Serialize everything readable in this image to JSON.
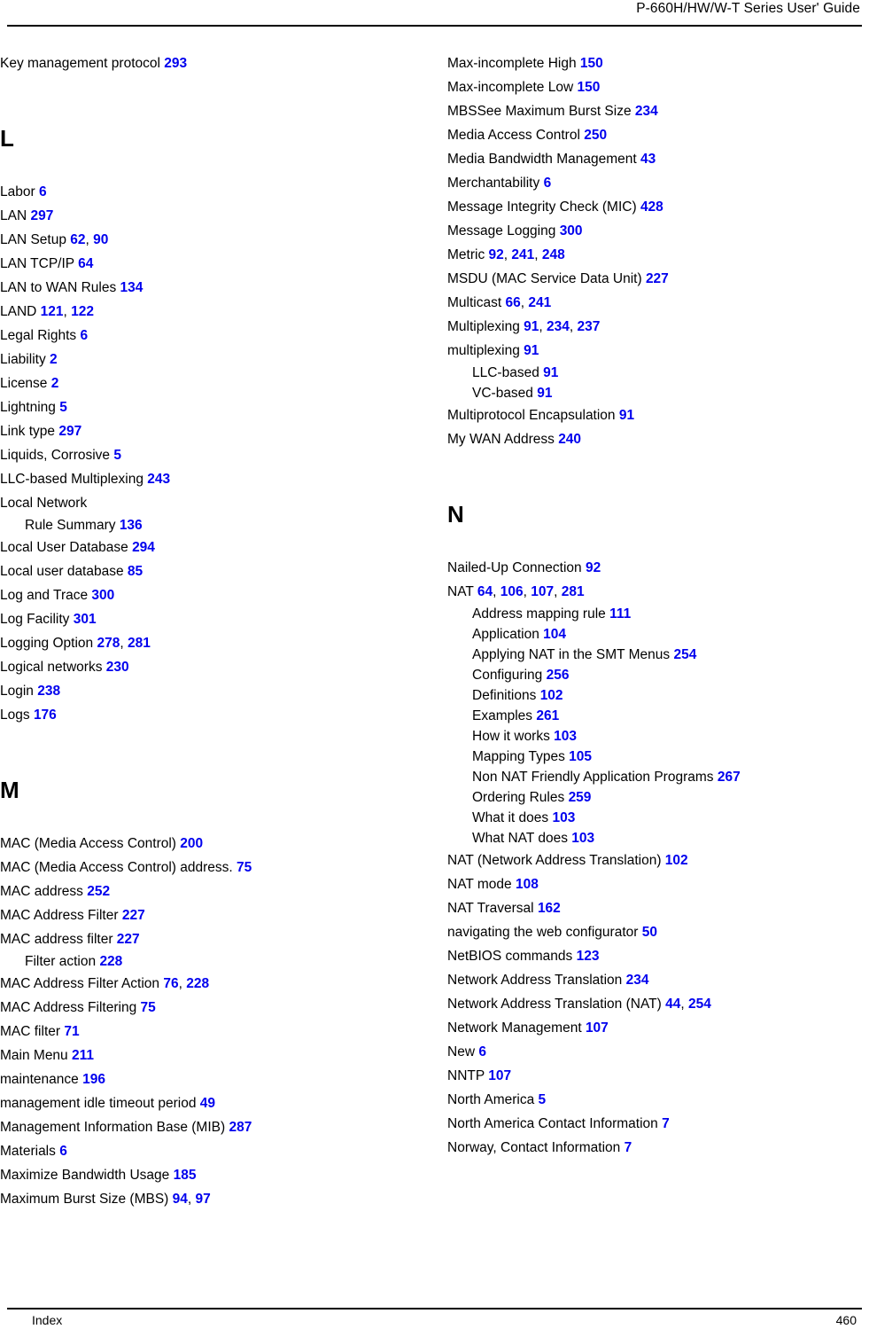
{
  "header": {
    "title": "P-660H/HW/W-T Series User' Guide"
  },
  "footer": {
    "section_label": "Index",
    "page_number": "460"
  },
  "colors": {
    "page_number_link": "#0000EE",
    "text": "#000000",
    "background": "#FFFFFF"
  },
  "index": {
    "left_column": {
      "lead_entries": [
        {
          "term": "Key management protocol",
          "pages": [
            "293"
          ],
          "level": 0
        }
      ],
      "groups": [
        {
          "letter": "L",
          "entries": [
            {
              "term": "Labor",
              "pages": [
                "6"
              ],
              "level": 0
            },
            {
              "term": "LAN",
              "pages": [
                "297"
              ],
              "level": 0
            },
            {
              "term": "LAN Setup",
              "pages": [
                "62",
                "90"
              ],
              "level": 0
            },
            {
              "term": "LAN TCP/IP",
              "pages": [
                "64"
              ],
              "level": 0
            },
            {
              "term": "LAN to WAN Rules",
              "pages": [
                "134"
              ],
              "level": 0
            },
            {
              "term": "LAND",
              "pages": [
                "121",
                "122"
              ],
              "level": 0
            },
            {
              "term": "Legal Rights",
              "pages": [
                "6"
              ],
              "level": 0
            },
            {
              "term": "Liability",
              "pages": [
                "2"
              ],
              "level": 0
            },
            {
              "term": "License",
              "pages": [
                "2"
              ],
              "level": 0
            },
            {
              "term": "Lightning",
              "pages": [
                "5"
              ],
              "level": 0
            },
            {
              "term": "Link type",
              "pages": [
                "297"
              ],
              "level": 0
            },
            {
              "term": "Liquids, Corrosive",
              "pages": [
                "5"
              ],
              "level": 0
            },
            {
              "term": "LLC-based Multiplexing",
              "pages": [
                "243"
              ],
              "level": 0
            },
            {
              "term": "Local Network",
              "pages": [],
              "level": 0
            },
            {
              "term": "Rule Summary",
              "pages": [
                "136"
              ],
              "level": 1
            },
            {
              "term": "Local User Database",
              "pages": [
                "294"
              ],
              "level": 0
            },
            {
              "term": "Local user database",
              "pages": [
                "85"
              ],
              "level": 0
            },
            {
              "term": "Log and Trace",
              "pages": [
                "300"
              ],
              "level": 0
            },
            {
              "term": "Log Facility",
              "pages": [
                "301"
              ],
              "level": 0
            },
            {
              "term": "Logging Option",
              "pages": [
                "278",
                "281"
              ],
              "level": 0
            },
            {
              "term": "Logical networks",
              "pages": [
                "230"
              ],
              "level": 0
            },
            {
              "term": "Login",
              "pages": [
                "238"
              ],
              "level": 0
            },
            {
              "term": "Logs",
              "pages": [
                "176"
              ],
              "level": 0
            }
          ]
        },
        {
          "letter": "M",
          "entries": [
            {
              "term": "MAC (Media Access Control)",
              "pages": [
                "200"
              ],
              "level": 0
            },
            {
              "term": "MAC (Media Access Control) address.",
              "pages": [
                "75"
              ],
              "level": 0
            },
            {
              "term": "MAC address",
              "pages": [
                "252"
              ],
              "level": 0
            },
            {
              "term": "MAC Address Filter",
              "pages": [
                "227"
              ],
              "level": 0
            },
            {
              "term": "MAC address filter",
              "pages": [
                "227"
              ],
              "level": 0
            },
            {
              "term": "Filter action",
              "pages": [
                "228"
              ],
              "level": 1
            },
            {
              "term": "MAC Address Filter Action",
              "pages": [
                "76",
                "228"
              ],
              "level": 0
            },
            {
              "term": "MAC Address Filtering",
              "pages": [
                "75"
              ],
              "level": 0
            },
            {
              "term": "MAC filter",
              "pages": [
                "71"
              ],
              "level": 0
            },
            {
              "term": "Main Menu",
              "pages": [
                "211"
              ],
              "level": 0
            },
            {
              "term": "maintenance",
              "pages": [
                "196"
              ],
              "level": 0
            },
            {
              "term": "management idle timeout period",
              "pages": [
                "49"
              ],
              "level": 0
            },
            {
              "term": "Management Information Base (MIB)",
              "pages": [
                "287"
              ],
              "level": 0
            },
            {
              "term": "Materials",
              "pages": [
                "6"
              ],
              "level": 0
            },
            {
              "term": "Maximize Bandwidth Usage",
              "pages": [
                "185"
              ],
              "level": 0
            },
            {
              "term": "Maximum Burst Size (MBS)",
              "pages": [
                "94",
                "97"
              ],
              "level": 0
            }
          ]
        }
      ]
    },
    "right_column": {
      "lead_entries": [
        {
          "term": "Max-incomplete High",
          "pages": [
            "150"
          ],
          "level": 0
        },
        {
          "term": "Max-incomplete Low",
          "pages": [
            "150"
          ],
          "level": 0
        },
        {
          "term": "MBSSee Maximum Burst Size",
          "pages": [
            "234"
          ],
          "level": 0
        },
        {
          "term": "Media Access Control",
          "pages": [
            "250"
          ],
          "level": 0
        },
        {
          "term": "Media Bandwidth Management",
          "pages": [
            "43"
          ],
          "level": 0
        },
        {
          "term": "Merchantability",
          "pages": [
            "6"
          ],
          "level": 0
        },
        {
          "term": "Message Integrity Check (MIC)",
          "pages": [
            "428"
          ],
          "level": 0
        },
        {
          "term": "Message Logging",
          "pages": [
            "300"
          ],
          "level": 0
        },
        {
          "term": "Metric",
          "pages": [
            "92",
            "241",
            "248"
          ],
          "level": 0
        },
        {
          "term": "MSDU (MAC Service Data Unit)",
          "pages": [
            "227"
          ],
          "level": 0
        },
        {
          "term": "Multicast",
          "pages": [
            "66",
            "241"
          ],
          "level": 0
        },
        {
          "term": "Multiplexing",
          "pages": [
            "91",
            "234",
            "237"
          ],
          "level": 0
        },
        {
          "term": "multiplexing",
          "pages": [
            "91"
          ],
          "level": 0
        },
        {
          "term": "LLC-based",
          "pages": [
            "91"
          ],
          "level": 1
        },
        {
          "term": "VC-based",
          "pages": [
            "91"
          ],
          "level": 1
        },
        {
          "term": "Multiprotocol Encapsulation",
          "pages": [
            "91"
          ],
          "level": 0
        },
        {
          "term": "My WAN Address",
          "pages": [
            "240"
          ],
          "level": 0
        }
      ],
      "groups": [
        {
          "letter": "N",
          "entries": [
            {
              "term": "Nailed-Up Connection",
              "pages": [
                "92"
              ],
              "level": 0
            },
            {
              "term": "NAT",
              "pages": [
                "64",
                "106",
                "107",
                "281"
              ],
              "level": 0
            },
            {
              "term": "Address mapping rule",
              "pages": [
                "111"
              ],
              "level": 1
            },
            {
              "term": "Application",
              "pages": [
                "104"
              ],
              "level": 1
            },
            {
              "term": "Applying NAT in the SMT Menus",
              "pages": [
                "254"
              ],
              "level": 1
            },
            {
              "term": "Configuring",
              "pages": [
                "256"
              ],
              "level": 1
            },
            {
              "term": "Definitions",
              "pages": [
                "102"
              ],
              "level": 1
            },
            {
              "term": "Examples",
              "pages": [
                "261"
              ],
              "level": 1
            },
            {
              "term": "How it works",
              "pages": [
                "103"
              ],
              "level": 1
            },
            {
              "term": "Mapping Types",
              "pages": [
                "105"
              ],
              "level": 1
            },
            {
              "term": "Non NAT Friendly Application Programs",
              "pages": [
                "267"
              ],
              "level": 1
            },
            {
              "term": "Ordering Rules",
              "pages": [
                "259"
              ],
              "level": 1
            },
            {
              "term": "What it does",
              "pages": [
                "103"
              ],
              "level": 1
            },
            {
              "term": "What NAT does",
              "pages": [
                "103"
              ],
              "level": 1
            },
            {
              "term": "NAT (Network Address Translation)",
              "pages": [
                "102"
              ],
              "level": 0
            },
            {
              "term": "NAT mode",
              "pages": [
                "108"
              ],
              "level": 0
            },
            {
              "term": "NAT Traversal",
              "pages": [
                "162"
              ],
              "level": 0
            },
            {
              "term": "navigating the web configurator",
              "pages": [
                "50"
              ],
              "level": 0
            },
            {
              "term": "NetBIOS commands",
              "pages": [
                "123"
              ],
              "level": 0
            },
            {
              "term": "Network Address Translation",
              "pages": [
                "234"
              ],
              "level": 0
            },
            {
              "term": "Network Address Translation (NAT)",
              "pages": [
                "44",
                "254"
              ],
              "level": 0
            },
            {
              "term": "Network Management",
              "pages": [
                "107"
              ],
              "level": 0
            },
            {
              "term": "New",
              "pages": [
                "6"
              ],
              "level": 0
            },
            {
              "term": "NNTP",
              "pages": [
                "107"
              ],
              "level": 0
            },
            {
              "term": "North America",
              "pages": [
                "5"
              ],
              "level": 0
            },
            {
              "term": "North America Contact Information",
              "pages": [
                "7"
              ],
              "level": 0
            },
            {
              "term": "Norway, Contact Information",
              "pages": [
                "7"
              ],
              "level": 0
            }
          ]
        }
      ]
    }
  }
}
